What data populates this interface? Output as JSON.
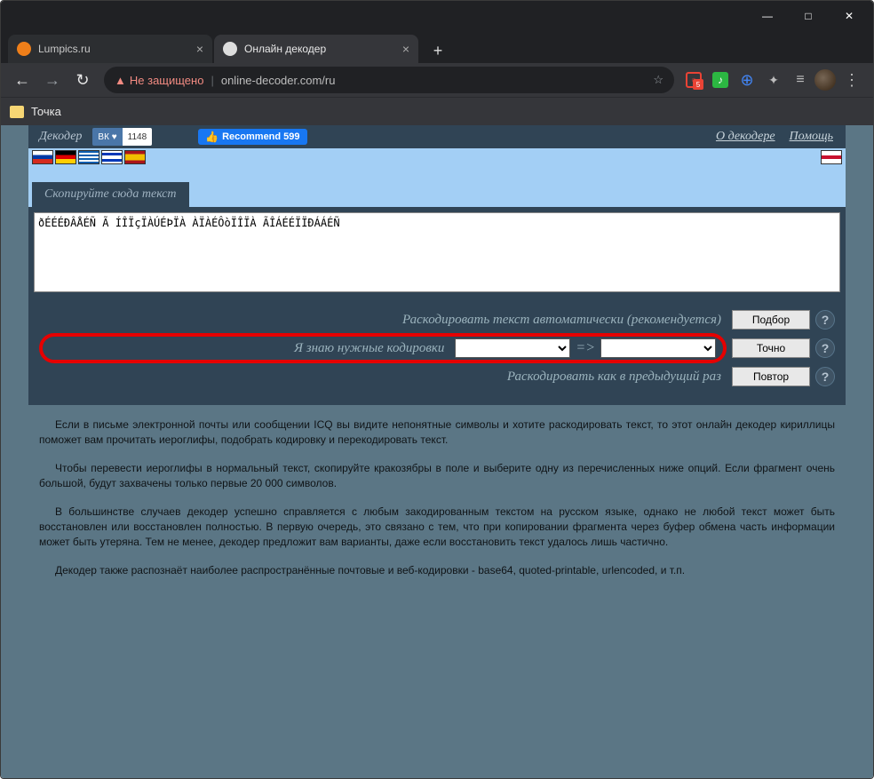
{
  "titlebar": {
    "min": "—",
    "max": "□",
    "close": "✕"
  },
  "tabs": [
    {
      "title": "Lumpics.ru",
      "active": false
    },
    {
      "title": "Онлайн декодер",
      "active": true
    }
  ],
  "nav": {
    "back": "←",
    "fwd": "→",
    "reload": "↻",
    "warn_tri": "▲",
    "warn_text": "Не защищено",
    "url": "online-decoder.com/ru",
    "star": "☆",
    "badge": "5",
    "menu_dots": "⋮",
    "newtab": "+",
    "list": "≡",
    "puzzle": "✦"
  },
  "bookmark": {
    "label": "Точка"
  },
  "header": {
    "brand": "Декодер",
    "vk_label": "ВК ♥",
    "vk_count": "1148",
    "fb_label": "Recommend 599",
    "links": [
      "О декодере",
      "Помощь"
    ]
  },
  "tabhead": "Скопируйте сюда текст",
  "textarea": "ðÉÉÉÐÂÅÉÑ Ã ÍÎÏçÏÀÚÉÞÏÀ ÀÏÀÉÔòÏÎÏÀ ÃÎÁÉÉÏÏÐÁÁÉÑ",
  "opts": {
    "auto": "Раскодировать текст автоматически (рекомендуется)",
    "auto_btn": "Подбор",
    "know": "Я знаю нужные кодировки",
    "know_btn": "Точно",
    "arrow": "=>",
    "prev": "Раскодировать как в предыдущий раз",
    "prev_btn": "Повтор",
    "help": "?"
  },
  "article": {
    "p1": "Если в письме электронной почты или сообщении ICQ вы видите непонятные символы и хотите раскодировать текст, то этот онлайн декодер кириллицы поможет вам прочитать иероглифы, подобрать кодировку и перекодировать текст.",
    "p2": "Чтобы перевести иероглифы в нормальный текст, скопируйте кракозябры в поле и выберите одну из перечисленных ниже опций. Если фрагмент очень большой, будут захвачены только первые 20 000 символов.",
    "p3": "В большинстве случаев декодер успешно справляется с любым закодированным текстом на русском языке, однако не любой текст может быть восстановлен или восстановлен полностью. В первую очередь, это связано с тем, что при копировании фрагмента через буфер обмена часть информации может быть утеряна. Тем не менее, декодер предложит вам варианты, даже если восстановить текст удалось лишь частично.",
    "p4": "Декодер также распознаёт наиболее распространённые почтовые и веб-кодировки - base64, quoted-printable, urlencoded, и т.п."
  }
}
